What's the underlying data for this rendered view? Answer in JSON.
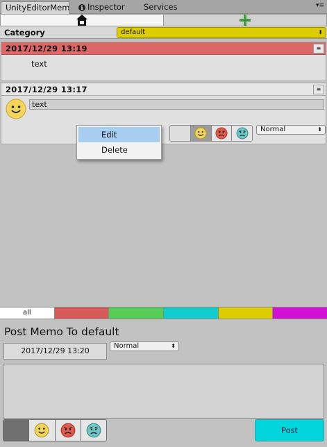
{
  "tabs": [
    {
      "label": "UnityEditorMem"
    },
    {
      "label": "Inspector"
    },
    {
      "label": "Services"
    }
  ],
  "category": {
    "label": "Category",
    "selected": "default",
    "color": "#dccd00"
  },
  "memos": [
    {
      "date": "2017/12/29 13:19",
      "text": "text",
      "color": "#dd6666"
    },
    {
      "date": "2017/12/29 13:17",
      "text": "text",
      "level": "Normal",
      "selected_emotion": "happy"
    }
  ],
  "context_menu": {
    "items": [
      {
        "label": "Edit",
        "highlighted": true
      },
      {
        "label": "Delete",
        "highlighted": false
      }
    ]
  },
  "filter_tabs": [
    {
      "label": "all",
      "color": "#ffffff"
    },
    {
      "label": "",
      "color": "#d65a5a"
    },
    {
      "label": "",
      "color": "#55cc55"
    },
    {
      "label": "",
      "color": "#11cccc"
    },
    {
      "label": "",
      "color": "#dccd00"
    },
    {
      "label": "",
      "color": "#d111d4"
    }
  ],
  "post": {
    "title": "Post Memo To default",
    "date": "2017/12/29 13:20",
    "level": "Normal",
    "button_label": "Post",
    "button_color": "#00d6dc"
  },
  "icons": {
    "home": "home-icon",
    "add": "plus-icon",
    "info": "info-icon",
    "menu": "hamburger-icon",
    "emotions": [
      "happy-face-icon",
      "angry-face-icon",
      "sad-face-icon"
    ]
  }
}
